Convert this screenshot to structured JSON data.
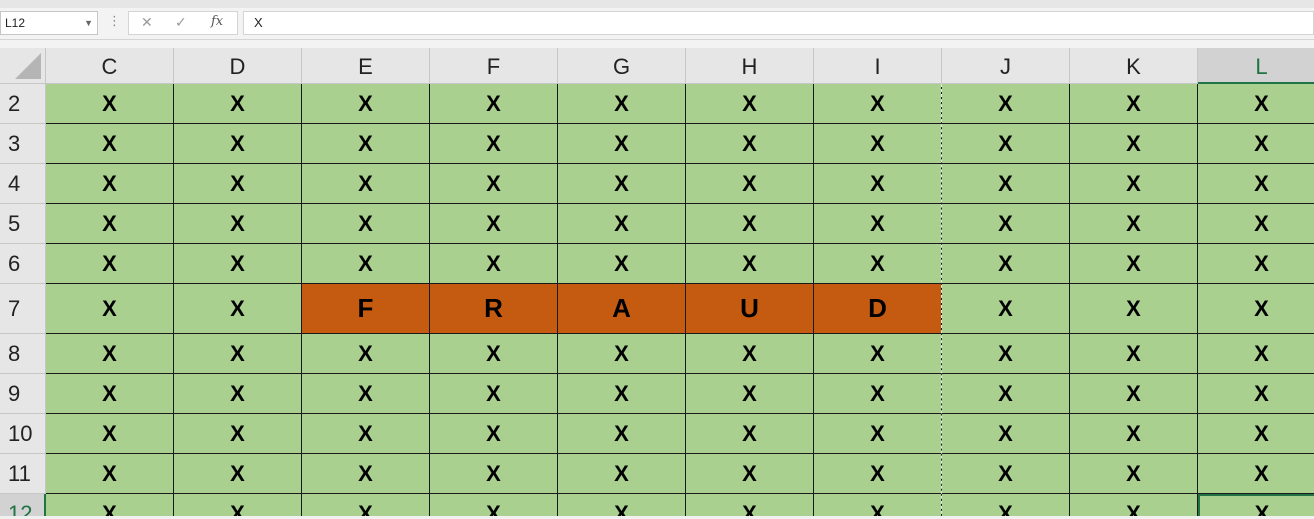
{
  "name_box": {
    "value": "L12"
  },
  "formula_bar": {
    "cancel_symbol": "✕",
    "enter_symbol": "✓",
    "fx_label": "fx",
    "value": "X",
    "dots": "⋮"
  },
  "columns": [
    "C",
    "D",
    "E",
    "F",
    "G",
    "H",
    "I",
    "J",
    "K",
    "L"
  ],
  "rows": [
    "2",
    "3",
    "4",
    "5",
    "6",
    "7",
    "8",
    "9",
    "10",
    "11",
    "12"
  ],
  "fill_char": "X",
  "fraud_row": "7",
  "fraud_letters": [
    "F",
    "R",
    "A",
    "U",
    "D"
  ],
  "active_cell": "L12",
  "colors": {
    "green_fill": "#a9d08e",
    "fraud_fill": "#c55a11",
    "selection": "#217346"
  }
}
